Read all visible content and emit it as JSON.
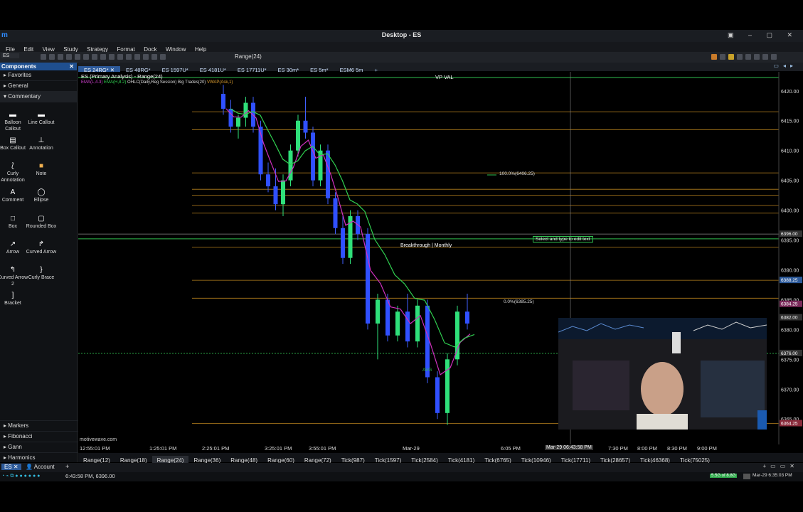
{
  "window": {
    "title": "Desktop - ES"
  },
  "menu": [
    "File",
    "Edit",
    "View",
    "Study",
    "Strategy",
    "Format",
    "Dock",
    "Window",
    "Help"
  ],
  "toolbar": {
    "symbol": "ES",
    "range_select": "Range(24)"
  },
  "tabs": [
    {
      "label": "ES 24RG*",
      "active": true
    },
    {
      "label": "ES 48RG*",
      "active": false
    },
    {
      "label": "ES 1597U*",
      "active": false
    },
    {
      "label": "ES 4181U*",
      "active": false
    },
    {
      "label": "ES 17711U*",
      "active": false
    },
    {
      "label": "ES 30m*",
      "active": false
    },
    {
      "label": "ES 5m*",
      "active": false
    },
    {
      "label": "ESM6 5m",
      "active": false
    }
  ],
  "sidebar": {
    "title": "Components",
    "sections_top": [
      "Favorites",
      "General",
      "Commentary"
    ],
    "tools": [
      {
        "label": "Balloon Callout",
        "glyph": "▬"
      },
      {
        "label": "Line Callout",
        "glyph": "▬"
      },
      {
        "label": "Box Callout",
        "glyph": "▤"
      },
      {
        "label": "Annotation",
        "glyph": "⊥"
      },
      {
        "label": "Curly Annotation",
        "glyph": "⟅"
      },
      {
        "label": "Note",
        "glyph": "■"
      },
      {
        "label": "Comment",
        "glyph": "A"
      },
      {
        "label": "Ellipse",
        "glyph": "◯"
      },
      {
        "label": "Box",
        "glyph": "□"
      },
      {
        "label": "Rounded Box",
        "glyph": "▢"
      },
      {
        "label": "Arrow",
        "glyph": "↗"
      },
      {
        "label": "Curved Arrow",
        "glyph": "↱"
      },
      {
        "label": "Curved Arrow 2",
        "glyph": "↰"
      },
      {
        "label": "Curly Brace",
        "glyph": "}"
      },
      {
        "label": "Bracket",
        "glyph": "]"
      }
    ],
    "sections_bottom": [
      "Markers",
      "Fibonacci",
      "Gann",
      "Harmonics"
    ]
  },
  "chart": {
    "header": "ES (Primary Analysis) - Range(24)",
    "studies": [
      "EMA(L,4.3)",
      "EMA(H,8.2)",
      "OHLC(Daily,Reg Session)",
      "Big Trades(20)",
      "VWAP(Ask,1)"
    ],
    "watermark": "motivewave.com",
    "vp_val": "VP VAL",
    "fib_100": "100.0%(6406.25)",
    "fib_0": "0.0%(6385.25)",
    "breakthrough": "Breakthrough | Monthly",
    "select_text": "Select and type to edit text",
    "vwap_label": "AVG",
    "price_ticks": [
      "6420.00",
      "6415.00",
      "6410.00",
      "6405.00",
      "6400.00",
      "6395.00",
      "6390.00",
      "6385.00",
      "6380.00",
      "6375.00",
      "6370.00",
      "6365.00"
    ],
    "price_badges": [
      {
        "value": "6396.00",
        "color": "#333"
      },
      {
        "value": "6388.25",
        "color": "#2d5a9a"
      },
      {
        "value": "6384.25",
        "color": "#7a2a5a"
      },
      {
        "value": "6382.00",
        "color": "#333"
      },
      {
        "value": "6376.00",
        "color": "#333"
      },
      {
        "value": "6364.25",
        "color": "#8a2a3a"
      }
    ],
    "time_ticks": [
      "12:55:01 PM",
      "1:25:01 PM",
      "2:25:01 PM",
      "3:25:01 PM",
      "3:55:01 PM",
      "Mar-29",
      "6:05 PM",
      "7:30 PM",
      "8:00 PM",
      "8:30 PM",
      "9:00 PM"
    ],
    "time_cursor": "Mar-29 06:43:58 PM"
  },
  "chart_data": {
    "type": "candlestick",
    "y_range": [
      6363,
      6422
    ],
    "candles": [
      {
        "o": 6419.5,
        "h": 6421,
        "l": 6416,
        "c": 6417,
        "x": 0.22
      },
      {
        "o": 6417,
        "h": 6418.5,
        "l": 6413,
        "c": 6414,
        "x": 0.235
      },
      {
        "o": 6414,
        "h": 6416,
        "l": 6412,
        "c": 6415.5,
        "x": 0.25
      },
      {
        "o": 6415.5,
        "h": 6419,
        "l": 6414,
        "c": 6418,
        "x": 0.265
      },
      {
        "o": 6418,
        "h": 6419,
        "l": 6413,
        "c": 6414,
        "x": 0.28
      },
      {
        "o": 6414,
        "h": 6415,
        "l": 6405,
        "c": 6406,
        "x": 0.295
      },
      {
        "o": 6406,
        "h": 6408,
        "l": 6403,
        "c": 6404,
        "x": 0.31
      },
      {
        "o": 6404,
        "h": 6407,
        "l": 6400,
        "c": 6401,
        "x": 0.325
      },
      {
        "o": 6401,
        "h": 6406,
        "l": 6399,
        "c": 6405,
        "x": 0.34
      },
      {
        "o": 6405,
        "h": 6411,
        "l": 6404,
        "c": 6410,
        "x": 0.355
      },
      {
        "o": 6410,
        "h": 6416,
        "l": 6409,
        "c": 6415,
        "x": 0.37
      },
      {
        "o": 6415,
        "h": 6419,
        "l": 6412,
        "c": 6413,
        "x": 0.385
      },
      {
        "o": 6413,
        "h": 6414,
        "l": 6404,
        "c": 6405,
        "x": 0.4
      },
      {
        "o": 6405,
        "h": 6411,
        "l": 6404,
        "c": 6410,
        "x": 0.415
      },
      {
        "o": 6410,
        "h": 6411,
        "l": 6401,
        "c": 6402,
        "x": 0.43
      },
      {
        "o": 6402,
        "h": 6403,
        "l": 6396,
        "c": 6397,
        "x": 0.445
      },
      {
        "o": 6397,
        "h": 6399,
        "l": 6391,
        "c": 6392,
        "x": 0.46
      },
      {
        "o": 6392,
        "h": 6400,
        "l": 6391,
        "c": 6399,
        "x": 0.475
      },
      {
        "o": 6399,
        "h": 6400,
        "l": 6395,
        "c": 6396,
        "x": 0.49
      },
      {
        "o": 6396,
        "h": 6397,
        "l": 6380,
        "c": 6381,
        "x": 0.51
      },
      {
        "o": 6381,
        "h": 6386,
        "l": 6375,
        "c": 6385,
        "x": 0.53
      },
      {
        "o": 6385,
        "h": 6386,
        "l": 6378,
        "c": 6379,
        "x": 0.55
      },
      {
        "o": 6379,
        "h": 6384,
        "l": 6378,
        "c": 6383,
        "x": 0.57
      },
      {
        "o": 6383,
        "h": 6386,
        "l": 6377,
        "c": 6378,
        "x": 0.59
      },
      {
        "o": 6378,
        "h": 6385,
        "l": 6377,
        "c": 6384,
        "x": 0.61
      },
      {
        "o": 6384,
        "h": 6385,
        "l": 6371,
        "c": 6372,
        "x": 0.63
      },
      {
        "o": 6372,
        "h": 6373,
        "l": 6365,
        "c": 6366,
        "x": 0.65
      },
      {
        "o": 6366,
        "h": 6376,
        "l": 6364,
        "c": 6375,
        "x": 0.67
      },
      {
        "o": 6375,
        "h": 6384,
        "l": 6374,
        "c": 6383,
        "x": 0.69
      },
      {
        "o": 6383,
        "h": 6386,
        "l": 6380,
        "c": 6381,
        "x": 0.71
      }
    ]
  },
  "bottom_ranges": [
    "Range(12)",
    "Range(18)",
    "Range(24)",
    "Range(36)",
    "Range(48)",
    "Range(60)",
    "Range(72)",
    "Tick(987)",
    "Tick(1597)",
    "Tick(2584)",
    "Tick(4181)",
    "Tick(6765)",
    "Tick(10946)",
    "Tick(17711)",
    "Tick(28657)",
    "Tick(46368)",
    "Tick(75025)"
  ],
  "bottom_range_selected": "Range(24)",
  "bottom_tabs": [
    "ES",
    "Account"
  ],
  "status": {
    "left": "6:43:58 PM, 6396.00",
    "right": "Mar-29 6:35:03 PM",
    "badge": "5.5G of 8.8G"
  }
}
